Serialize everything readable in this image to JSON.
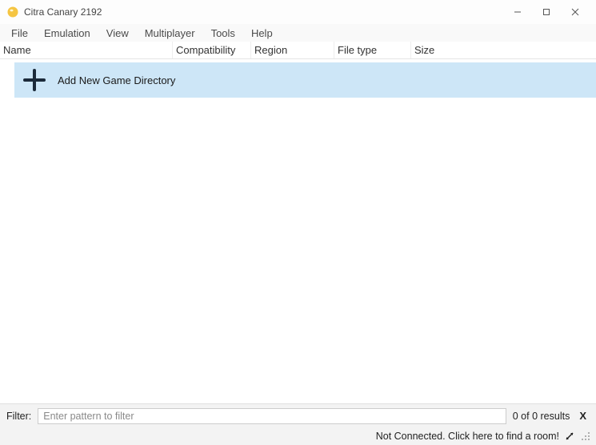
{
  "window": {
    "title": "Citra Canary 2192"
  },
  "menubar": {
    "items": [
      "File",
      "Emulation",
      "View",
      "Multiplayer",
      "Tools",
      "Help"
    ]
  },
  "columns": {
    "name": "Name",
    "compatibility": "Compatibility",
    "region": "Region",
    "filetype": "File type",
    "size": "Size"
  },
  "gamelist": {
    "add_directory_label": "Add New Game Directory"
  },
  "filter": {
    "label": "Filter:",
    "placeholder": "Enter pattern to filter",
    "results": "0 of 0 results",
    "clear": "X"
  },
  "status": {
    "text": "Not Connected. Click here to find a room!"
  }
}
